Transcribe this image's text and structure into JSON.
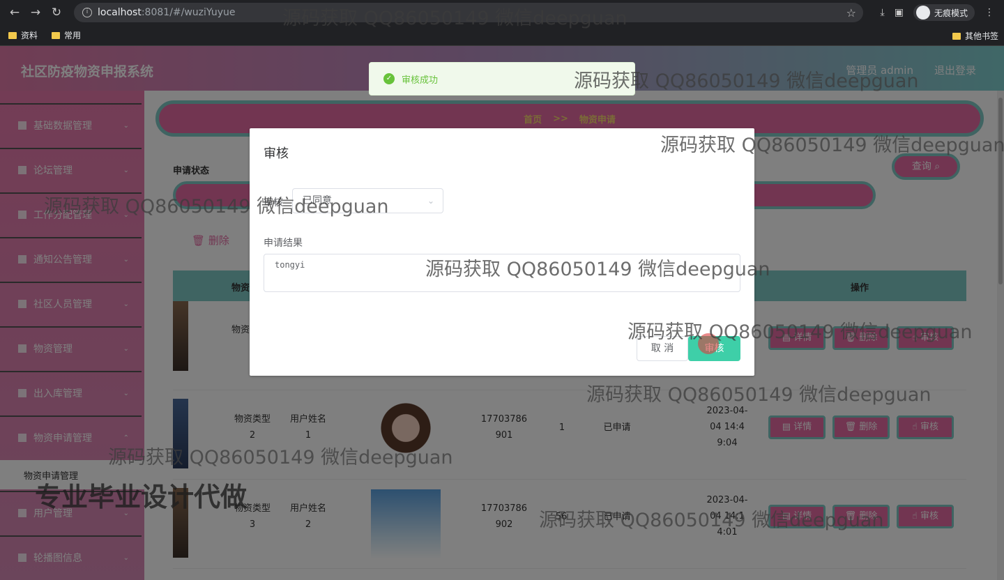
{
  "browser": {
    "url_host": "localhost",
    "url_rest": ":8081/#/wuziYuyue",
    "incognito_label": "无痕模式",
    "bookmarks": [
      "资料",
      "常用"
    ],
    "other_bookmarks": "其他书签"
  },
  "app": {
    "title": "社区防疫物资申报系统",
    "user": "管理员 admin",
    "logout": "退出登录"
  },
  "sidebar": {
    "items": [
      {
        "label": "基础数据管理",
        "icon": "send-icon"
      },
      {
        "label": "论坛管理",
        "icon": "list-icon"
      },
      {
        "label": "工作分配管理",
        "icon": "flag-icon"
      },
      {
        "label": "通知公告管理",
        "icon": "grid-icon"
      },
      {
        "label": "社区人员管理",
        "icon": "grid-icon"
      },
      {
        "label": "物资管理",
        "icon": "bar-chart-icon"
      },
      {
        "label": "出入库管理",
        "icon": "grid-icon"
      },
      {
        "label": "物资申请管理",
        "icon": "sliders-icon"
      },
      {
        "label": "用户管理",
        "icon": "grid-icon"
      },
      {
        "label": "轮播图信息",
        "icon": "menu-icon"
      }
    ],
    "active_sub": "物资申请管理"
  },
  "main": {
    "breadcrumb": {
      "home": "首页",
      "sep": ">>",
      "current": "物资申请"
    },
    "search_label": "申请状态",
    "query_button": "查询",
    "delete_button": "删除",
    "columns": [
      "物资",
      "操作"
    ],
    "rows": [
      {
        "type": "物资类型",
        "user": "",
        "phone": "",
        "qty": "",
        "status": "",
        "time": ""
      },
      {
        "type": "物资类型 2",
        "user": "用户姓名 1",
        "phone": "17703786901",
        "qty": "1",
        "status": "已申请",
        "time": "2023-04-04 14:49:04"
      },
      {
        "type": "物资类型 3",
        "user": "用户姓名 2",
        "phone": "17703786902",
        "qty": "56",
        "status": "已申请",
        "time": "2023-04-04 14:14:01"
      }
    ],
    "row_actions": {
      "detail": "详情",
      "delete": "删除",
      "review": "审核"
    }
  },
  "dialog": {
    "title": "审核",
    "review_label": "审核",
    "review_value": "已同意",
    "result_label": "申请结果",
    "result_value": "tongyi",
    "cancel": "取 消",
    "confirm": "审核"
  },
  "toast": {
    "message": "审核成功"
  },
  "watermarks": [
    "源码获取 QQ86050149 微信deepguan",
    "专业毕业设计代做"
  ]
}
